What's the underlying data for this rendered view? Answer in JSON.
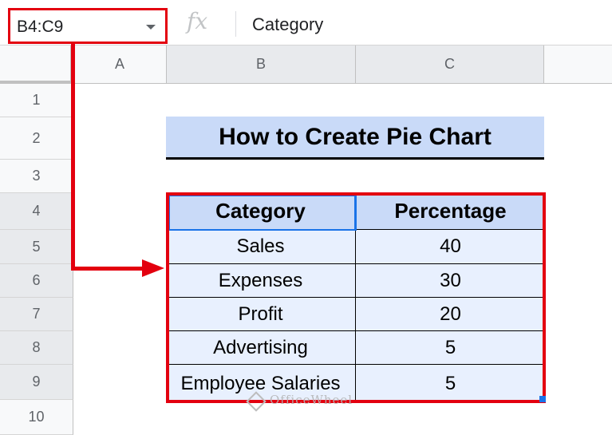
{
  "formula_bar": {
    "name_box": "B4:C9",
    "fx_label": "fx",
    "content": "Category"
  },
  "column_headers": [
    "A",
    "B",
    "C"
  ],
  "row_headers": [
    "1",
    "2",
    "3",
    "4",
    "5",
    "6",
    "7",
    "8",
    "9",
    "10"
  ],
  "sheet": {
    "title": "How to Create Pie Chart",
    "table": {
      "headers": [
        "Category",
        "Percentage"
      ],
      "rows": [
        [
          "Sales",
          "40"
        ],
        [
          "Expenses",
          "30"
        ],
        [
          "Profit",
          "20"
        ],
        [
          "Advertising",
          "5"
        ],
        [
          "Employee Salaries",
          "5"
        ]
      ]
    }
  },
  "watermark": "OfficeWheel",
  "colors": {
    "highlight_red": "#e3000f",
    "header_fill": "#c9daf8",
    "cell_fill": "#e8f0fe",
    "selection_blue": "#1a73e8"
  }
}
